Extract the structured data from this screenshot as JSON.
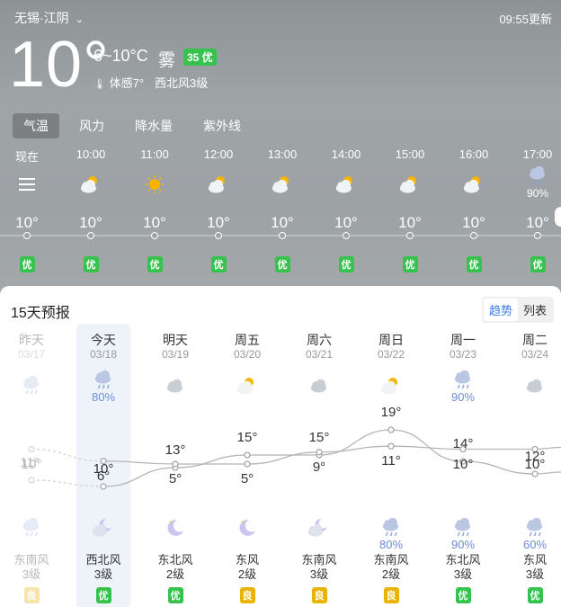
{
  "header": {
    "location": "无锡·江阴",
    "updated": "09:55更新",
    "current_temp": "10°",
    "range": "6~10°C",
    "weather": "雾",
    "aqi": "35 优",
    "feels_like": "体感7°",
    "wind": "西北风3级"
  },
  "tabs": [
    {
      "label": "气温",
      "active": true
    },
    {
      "label": "风力",
      "active": false
    },
    {
      "label": "降水量",
      "active": false
    },
    {
      "label": "紫外线",
      "active": false
    }
  ],
  "hourly": [
    {
      "time": "现在",
      "icon": "menu-icon",
      "temp": "10°",
      "aqi": "优",
      "pct": ""
    },
    {
      "time": "10:00",
      "icon": "partly-cloudy-icon",
      "temp": "10°",
      "aqi": "优",
      "pct": ""
    },
    {
      "time": "11:00",
      "icon": "sun-icon",
      "temp": "10°",
      "aqi": "优",
      "pct": ""
    },
    {
      "time": "12:00",
      "icon": "partly-cloudy-icon",
      "temp": "10°",
      "aqi": "优",
      "pct": ""
    },
    {
      "time": "13:00",
      "icon": "partly-cloudy-icon",
      "temp": "10°",
      "aqi": "优",
      "pct": ""
    },
    {
      "time": "14:00",
      "icon": "partly-cloudy-icon",
      "temp": "10°",
      "aqi": "优",
      "pct": ""
    },
    {
      "time": "15:00",
      "icon": "partly-cloudy-icon",
      "temp": "10°",
      "aqi": "优",
      "pct": ""
    },
    {
      "time": "16:00",
      "icon": "partly-cloudy-icon",
      "temp": "10°",
      "aqi": "优",
      "pct": ""
    },
    {
      "time": "17:00",
      "icon": "rain-cloud-icon",
      "temp": "10°",
      "aqi": "优",
      "pct": "90%"
    }
  ],
  "forecast": {
    "title": "15天预报",
    "toggle": [
      "趋势",
      "列表"
    ],
    "days": [
      {
        "name": "昨天",
        "date": "03/17",
        "day_icon": "rain-cloud-icon",
        "day_pct": "",
        "high": "11°",
        "low": "10°",
        "night_icon": "rain-cloud-icon",
        "night_pct": "",
        "wind_dir": "东南风",
        "wind_lvl": "3级",
        "aqi": "良",
        "aqi_color": "#eab308",
        "faded": true
      },
      {
        "name": "今天",
        "date": "03/18",
        "day_icon": "rain-cloud-icon",
        "day_pct": "80%",
        "high": "10°",
        "low": "6°",
        "night_icon": "moon-cloud-icon",
        "night_pct": "",
        "wind_dir": "西北风",
        "wind_lvl": "3级",
        "aqi": "优",
        "aqi_color": "#36c24c",
        "faded": false
      },
      {
        "name": "明天",
        "date": "03/19",
        "day_icon": "cloud-icon",
        "day_pct": "",
        "high": "13°",
        "low": "5°",
        "night_icon": "moon-icon",
        "night_pct": "",
        "wind_dir": "东北风",
        "wind_lvl": "2级",
        "aqi": "优",
        "aqi_color": "#36c24c",
        "faded": false
      },
      {
        "name": "周五",
        "date": "03/20",
        "day_icon": "partly-cloudy-icon",
        "day_pct": "",
        "high": "15°",
        "low": "5°",
        "night_icon": "moon-icon",
        "night_pct": "",
        "wind_dir": "东风",
        "wind_lvl": "2级",
        "aqi": "良",
        "aqi_color": "#eab308",
        "faded": false
      },
      {
        "name": "周六",
        "date": "03/21",
        "day_icon": "cloud-icon",
        "day_pct": "",
        "high": "15°",
        "low": "9°",
        "night_icon": "moon-cloud-icon",
        "night_pct": "",
        "wind_dir": "东南风",
        "wind_lvl": "3级",
        "aqi": "良",
        "aqi_color": "#eab308",
        "faded": false
      },
      {
        "name": "周日",
        "date": "03/22",
        "day_icon": "partly-cloudy-icon",
        "day_pct": "",
        "high": "19°",
        "low": "11°",
        "night_icon": "rain-cloud-icon",
        "night_pct": "80%",
        "wind_dir": "东南风",
        "wind_lvl": "2级",
        "aqi": "良",
        "aqi_color": "#eab308",
        "faded": false
      },
      {
        "name": "周一",
        "date": "03/23",
        "day_icon": "rain-cloud-icon",
        "day_pct": "90%",
        "high": "14°",
        "low": "10°",
        "night_icon": "rain-cloud-icon",
        "night_pct": "90%",
        "wind_dir": "东北风",
        "wind_lvl": "3级",
        "aqi": "优",
        "aqi_color": "#36c24c",
        "faded": false
      },
      {
        "name": "周二",
        "date": "03/24",
        "day_icon": "cloud-icon",
        "day_pct": "",
        "high": "12°",
        "low": "10°",
        "night_icon": "rain-cloud-icon",
        "night_pct": "60%",
        "wind_dir": "东风",
        "wind_lvl": "3级",
        "aqi": "优",
        "aqi_color": "#36c24c",
        "faded": false
      }
    ]
  },
  "chart_data": {
    "type": "line",
    "categories": [
      "03/17",
      "03/18",
      "03/19",
      "03/20",
      "03/21",
      "03/22",
      "03/23",
      "03/24"
    ],
    "series": [
      {
        "values": [
          11,
          10,
          13,
          15,
          15,
          19,
          14,
          12
        ]
      },
      {
        "values": [
          10,
          6,
          5,
          5,
          9,
          11,
          10,
          10
        ]
      }
    ]
  }
}
